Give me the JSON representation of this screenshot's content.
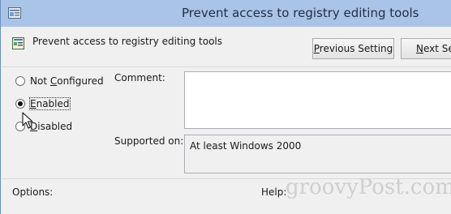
{
  "window": {
    "title": "Prevent access to registry editing tools"
  },
  "header": {
    "policy_name": "Prevent access to registry editing tools",
    "previous_button": {
      "prefix": "",
      "accel": "P",
      "rest": "revious Setting"
    },
    "next_button": {
      "prefix": "",
      "accel": "N",
      "rest": "ext Set"
    }
  },
  "state_options": [
    {
      "pre": "Not ",
      "accel": "C",
      "post": "onfigured",
      "selected": false
    },
    {
      "pre": "",
      "accel": "E",
      "post": "nabled",
      "selected": true
    },
    {
      "pre": "",
      "accel": "D",
      "post": "isabled",
      "selected": false
    }
  ],
  "comment": {
    "label": "Comment:",
    "value": ""
  },
  "supported_on": {
    "label": "Supported on:",
    "value": "At least Windows 2000"
  },
  "options_label": "Options:",
  "help_label": "Help:",
  "watermark": "groovyPost.com",
  "colors": {
    "titlebar": "#aac4e8",
    "window_bg": "#f0f0f0",
    "border": "#abadb3"
  }
}
